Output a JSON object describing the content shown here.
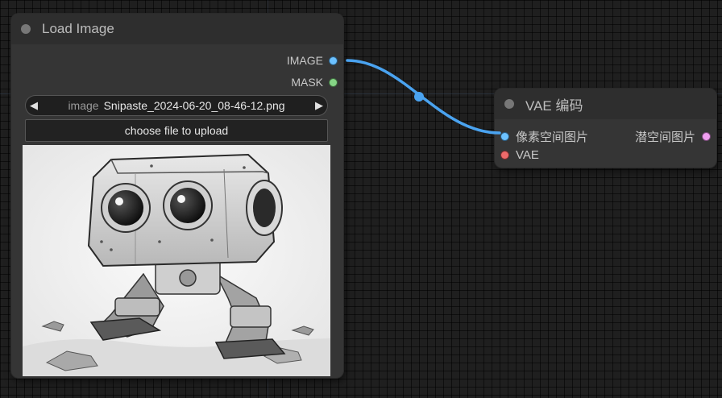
{
  "nodes": {
    "load_image": {
      "title": "Load Image",
      "outputs": {
        "image": "IMAGE",
        "mask": "MASK"
      },
      "image_widget": {
        "name": "image",
        "value": "Snipaste_2024-06-20_08-46-12.png",
        "prev_arrow": "◀",
        "next_arrow": "▶"
      },
      "upload_button": "choose file to upload",
      "preview_icon": "robot-preview-image"
    },
    "vae_encode": {
      "title": "VAE 编码",
      "inputs": {
        "pixels": "像素空间图片",
        "vae": "VAE"
      },
      "outputs": {
        "latent": "潜空间图片"
      }
    }
  },
  "colors": {
    "canvas": "#1f1f1f",
    "node_body": "#353535",
    "node_title": "#2e2e2e",
    "link_image": "#4aa3f0",
    "port_image": "#6cc1ff",
    "port_mask": "#86d586",
    "port_vae": "#ef6a6a",
    "port_latent": "#ef9ff0"
  }
}
